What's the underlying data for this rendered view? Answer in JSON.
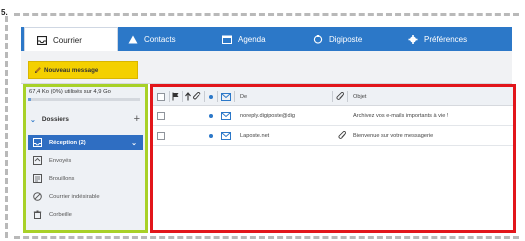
{
  "stage_label": "5.",
  "tabs": [
    {
      "label": "Courrier",
      "icon": "inbox-icon",
      "active": true
    },
    {
      "label": "Contacts",
      "icon": "contacts-icon",
      "active": false
    },
    {
      "label": "Agenda",
      "icon": "calendar-icon",
      "active": false
    },
    {
      "label": "Digiposte",
      "icon": "digiposte-icon",
      "active": false
    },
    {
      "label": "Préférences",
      "icon": "gear-icon",
      "active": false
    }
  ],
  "toolbar": {
    "new_message_label": "Nouveau message"
  },
  "sidebar": {
    "quota_text": "67,4 Ko (0%) utilisés sur 4,9 Go",
    "quota_fraction": 0.0,
    "folders_label": "Dossiers",
    "add_label": "+",
    "folders": [
      {
        "label": "Réception (2)",
        "icon": "inbox-icon",
        "active": true
      },
      {
        "label": "Envoyés",
        "icon": "sent-icon",
        "active": false
      },
      {
        "label": "Brouillons",
        "icon": "drafts-icon",
        "active": false
      },
      {
        "label": "Courrier indésirable",
        "icon": "spam-icon",
        "active": false
      },
      {
        "label": "Corbeille",
        "icon": "trash-icon",
        "active": false
      }
    ]
  },
  "message_list": {
    "columns": {
      "from": "De",
      "subject": "Objet"
    },
    "messages": [
      {
        "from": "noreply.digiposte@dig",
        "subject": "Archivez vos e-mails importants à vie !",
        "unread": true,
        "has_attachment": false
      },
      {
        "from": "Laposte.net",
        "subject": "Bienvenue sur votre messagerie",
        "unread": true,
        "has_attachment": true
      }
    ]
  },
  "colors": {
    "accent": "#2c78c8",
    "new_button": "#f4d000",
    "sidebar_outline": "#a8d128",
    "list_outline": "#e2161b"
  }
}
